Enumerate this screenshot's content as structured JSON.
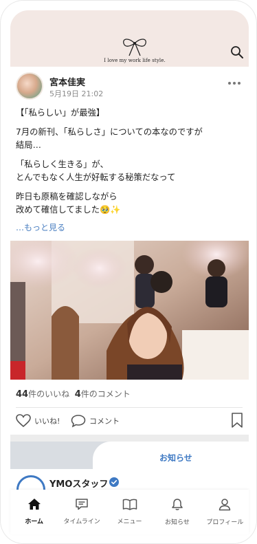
{
  "header": {
    "logo_mark": "yoshimi miyamoto",
    "tagline": "I love my work life style.",
    "search_icon": "search-icon"
  },
  "post": {
    "author": "宮本佳実",
    "date": "5月19日 21:02",
    "paragraphs": [
      [
        "【「私らしい」が最強】"
      ],
      [
        "7月の新刊、「私らしさ」についての本なのですが",
        "結局…"
      ],
      [
        "「私らしく生きる」が、",
        "とんでもなく人生が好転する秘策だなって"
      ],
      [
        "昨日も原稿を確認しながら",
        "改めて確信してました🥹✨"
      ]
    ],
    "see_more": "…もっと見る",
    "likes_count": "44",
    "likes_suffix": "件のいいね",
    "comments_count": "4",
    "comments_suffix": "件のコメント",
    "like_label": "いいね!",
    "comment_label": "コメント"
  },
  "notice": {
    "tab_label": "お知らせ",
    "staff_name": "YMOスタッフ"
  },
  "nav": [
    {
      "label": "ホーム",
      "icon": "home-icon",
      "active": true
    },
    {
      "label": "タイムライン",
      "icon": "timeline-icon",
      "active": false
    },
    {
      "label": "メニュー",
      "icon": "book-icon",
      "active": false
    },
    {
      "label": "お知らせ",
      "icon": "bell-icon",
      "active": false
    },
    {
      "label": "プロフィール",
      "icon": "user-icon",
      "active": false
    }
  ],
  "colors": {
    "header_bg": "#f3e8e4",
    "accent": "#3e79c3",
    "link": "#4a7fc1"
  }
}
